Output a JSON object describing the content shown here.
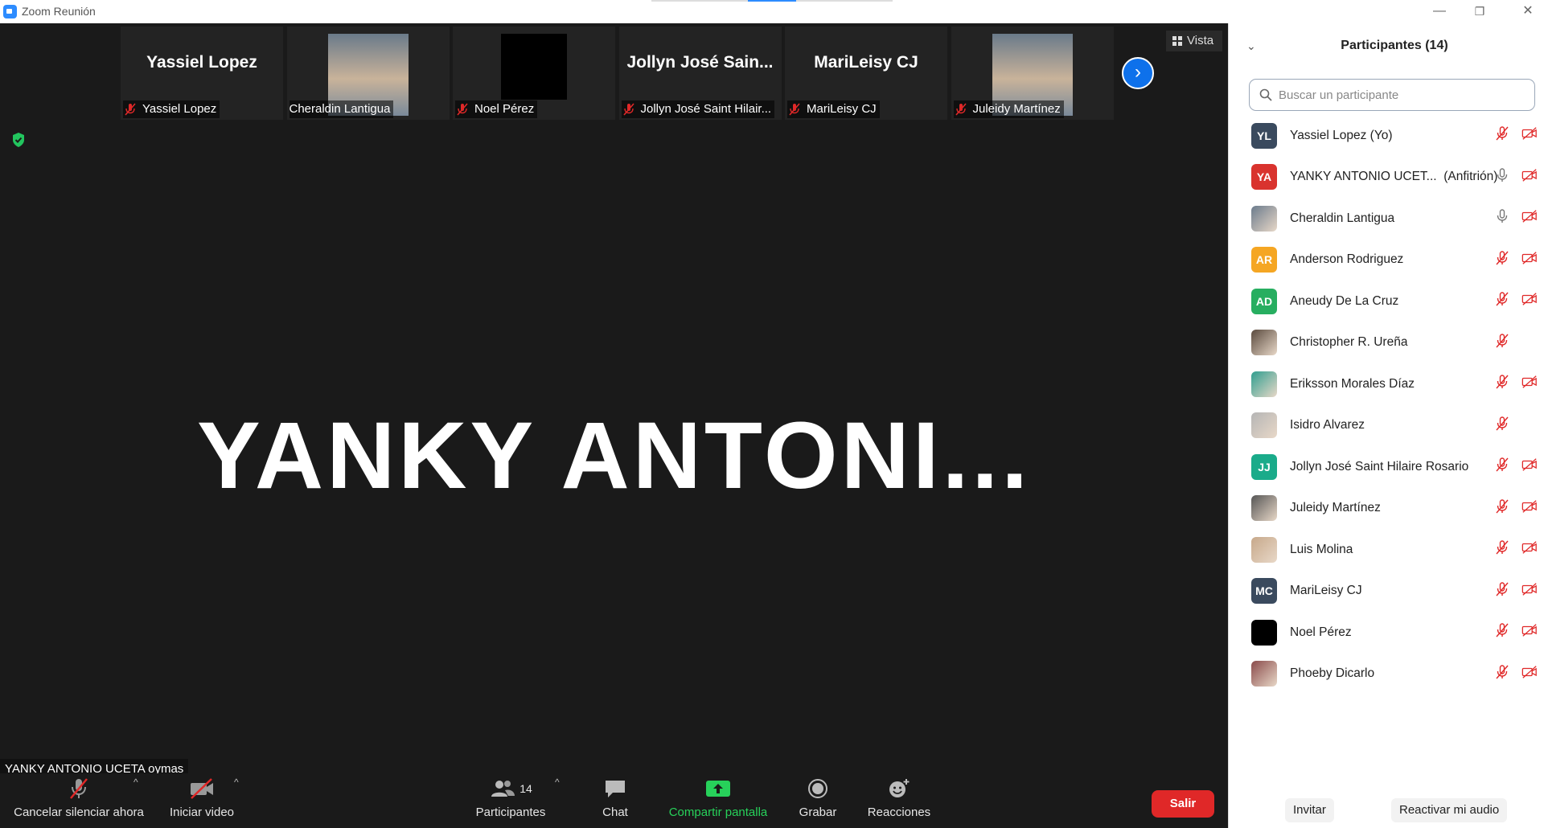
{
  "window": {
    "title": "Zoom Reunión",
    "minimize_label": "—",
    "restore_label": "❐",
    "close_label": "✕"
  },
  "thumbnails": [
    {
      "big_name": "Yassiel Lopez",
      "label": "Yassiel Lopez",
      "has_photo": false,
      "muted": true
    },
    {
      "big_name": "",
      "label": "Cheraldin Lantigua",
      "has_photo": true,
      "muted": false
    },
    {
      "big_name": "",
      "label": "Noel Pérez",
      "has_photo": false,
      "muted": true
    },
    {
      "big_name": "Jollyn  José  Sain...",
      "label": "Jollyn José Saint Hilair...",
      "has_photo": false,
      "muted": true
    },
    {
      "big_name": "MariLeisy CJ",
      "label": "MariLeisy CJ",
      "has_photo": false,
      "muted": true
    },
    {
      "big_name": "",
      "label": "Juleidy Martínez",
      "has_photo": true,
      "muted": true
    }
  ],
  "view_button": "Vista",
  "next_button_icon": "chevron-right-icon",
  "active_speaker": {
    "big_name": "YANKY  ANTONI...",
    "name_tag": "YANKY ANTONIO UCETA oymas"
  },
  "toolbar": {
    "unmute_label": "Cancelar silenciar ahora",
    "video_label": "Iniciar video",
    "participants_label": "Participantes",
    "participants_count": "14",
    "chat_label": "Chat",
    "share_label": "Compartir pantalla",
    "record_label": "Grabar",
    "reactions_label": "Reacciones",
    "leave_label": "Salir",
    "caret": "^"
  },
  "panel": {
    "title": "Participantes (14)",
    "search_placeholder": "Buscar un participante",
    "invite_label": "Invitar",
    "reactivate_audio_label": "Reactivar mi audio",
    "participants": [
      {
        "initials": "YL",
        "color": "#3a4a5e",
        "name": "Yassiel Lopez (Yo)",
        "role": "",
        "mic": "muted",
        "video": "off"
      },
      {
        "initials": "YA",
        "color": "#d9332e",
        "name": "YANKY ANTONIO UCET...",
        "role": "(Anfitrión)",
        "mic": "on",
        "video": "off"
      },
      {
        "initials": "",
        "color": "#6b7b8c",
        "name": "Cheraldin Lantigua",
        "role": "",
        "mic": "on",
        "video": "off",
        "photo": true
      },
      {
        "initials": "AR",
        "color": "#f5a623",
        "name": "Anderson Rodriguez",
        "role": "",
        "mic": "muted",
        "video": "off"
      },
      {
        "initials": "AD",
        "color": "#27ae60",
        "name": "Aneudy De La Cruz",
        "role": "",
        "mic": "muted",
        "video": "off"
      },
      {
        "initials": "",
        "color": "#5a4a3e",
        "name": "Christopher R. Ureña",
        "role": "",
        "mic": "muted",
        "video": "none",
        "photo": true
      },
      {
        "initials": "",
        "color": "#2f9e8f",
        "name": "Eriksson Morales Díaz",
        "role": "",
        "mic": "muted",
        "video": "off",
        "photo": true
      },
      {
        "initials": "",
        "color": "#b5b5b5",
        "name": "Isidro Alvarez",
        "role": "",
        "mic": "muted",
        "video": "none",
        "photo": true
      },
      {
        "initials": "JJ",
        "color": "#1aab8a",
        "name": "Jollyn José Saint Hilaire Rosario",
        "role": "",
        "mic": "muted",
        "video": "off"
      },
      {
        "initials": "",
        "color": "#555555",
        "name": "Juleidy Martínez",
        "role": "",
        "mic": "muted",
        "video": "off",
        "photo": true
      },
      {
        "initials": "",
        "color": "#c7a88a",
        "name": "Luis Molina",
        "role": "",
        "mic": "muted",
        "video": "off",
        "photo": true
      },
      {
        "initials": "MC",
        "color": "#3a4a5e",
        "name": "MariLeisy CJ",
        "role": "",
        "mic": "muted",
        "video": "off"
      },
      {
        "initials": "",
        "color": "#000000",
        "name": "Noel Pérez",
        "role": "",
        "mic": "muted",
        "video": "off"
      },
      {
        "initials": "",
        "color": "#8a4a4a",
        "name": "Phoeby Dicarlo",
        "role": "",
        "mic": "muted",
        "video": "off",
        "photo": true
      }
    ]
  },
  "colors": {
    "accent": "#0e71eb",
    "leave": "#e02828",
    "share": "#27d15a",
    "muted_icon": "#e02828"
  }
}
